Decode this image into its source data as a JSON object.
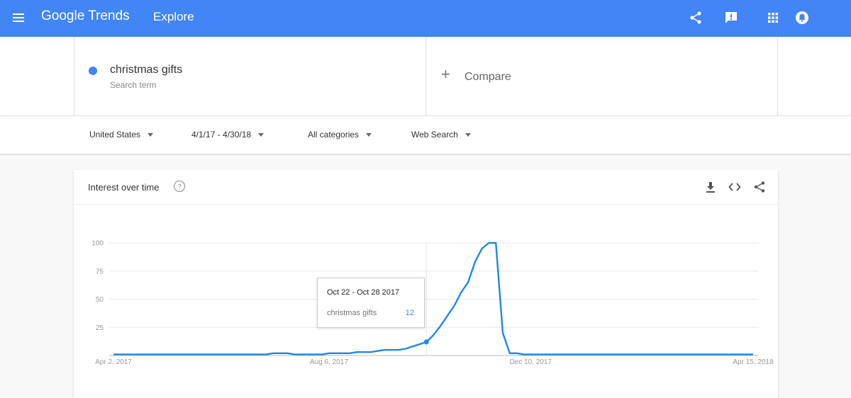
{
  "header": {
    "logo": "Google Trends",
    "section": "Explore",
    "icons": [
      "share-icon",
      "feedback-icon",
      "apps-icon",
      "notifications-icon"
    ]
  },
  "search": {
    "term": "christmas gifts",
    "term_type": "Search term",
    "compare_label": "Compare"
  },
  "filters": {
    "region": "United States",
    "date_range": "4/1/17 - 4/30/18",
    "category": "All categories",
    "search_type": "Web Search"
  },
  "card": {
    "title": "Interest over time",
    "icons": [
      "help-icon",
      "download-icon",
      "embed-icon",
      "share-icon"
    ]
  },
  "tooltip": {
    "date": "Oct 22 - Oct 28 2017",
    "term": "christmas gifts",
    "value": "12"
  },
  "colors": {
    "accent": "#4285f4",
    "line": "#1e88e5"
  },
  "chart_data": {
    "type": "line",
    "series": [
      {
        "name": "christmas gifts",
        "values": [
          1,
          1,
          1,
          1,
          1,
          1,
          1,
          1,
          1,
          1,
          1,
          1,
          1,
          1,
          1,
          1,
          1,
          1,
          1,
          1,
          1,
          1,
          1,
          2,
          2,
          2,
          1,
          1,
          1,
          1,
          1,
          2,
          2,
          2,
          2,
          3,
          3,
          3,
          4,
          5,
          5,
          5,
          6,
          8,
          10,
          12,
          18,
          26,
          35,
          44,
          56,
          65,
          83,
          95,
          100,
          100,
          20,
          2,
          2,
          1,
          1,
          1,
          1,
          1,
          1,
          1,
          1,
          1,
          1,
          1,
          1,
          1,
          1,
          1,
          1,
          1,
          1,
          1,
          1,
          1,
          1,
          1,
          1,
          1,
          1,
          1,
          1,
          1,
          1,
          1,
          1,
          1,
          1
        ]
      }
    ],
    "x_tick_labels": [
      "Apr 2, 2017",
      "Aug 6, 2017",
      "Dec 10, 2017",
      "Apr 15, 2018"
    ],
    "y_tick_labels": [
      "25",
      "50",
      "75",
      "100"
    ],
    "ylim": [
      0,
      100
    ],
    "grid": true,
    "highlight": {
      "label": "Oct 22 - Oct 28 2017",
      "value": 12
    }
  }
}
